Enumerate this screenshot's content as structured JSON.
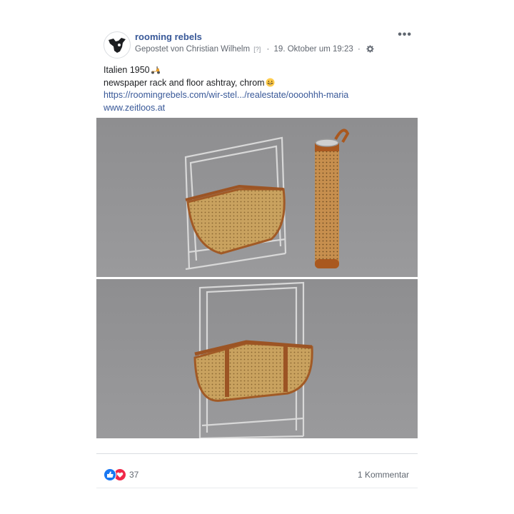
{
  "post": {
    "author": "rooming rebels",
    "posted_by": "Gepostet von Christian Wilhelm",
    "help_marker": "[?]",
    "separator": "·",
    "timestamp": "19. Oktober um 19:23",
    "lines": {
      "line1": "Italien 1950",
      "line2": "newspaper rack and floor ashtray, chrom",
      "link1": "https://roomingrebels.com/wir-stel.../realestate/oooohhh-maria",
      "link2": "www.zeitloos.at"
    },
    "icons": {
      "more": "more-options-icon",
      "audience": "gear-icon",
      "emoji1": "scooter-emoji",
      "emoji2": "grinning-emoji"
    },
    "photos": [
      {
        "subject": "photo-rack-and-ashtray"
      },
      {
        "subject": "photo-rack"
      }
    ]
  },
  "footer": {
    "reaction_count": "37",
    "comments_label": "1 Kommentar",
    "reactions": [
      "like",
      "love"
    ]
  },
  "colors": {
    "link": "#385898",
    "meta": "#616770",
    "like": "#1877f2",
    "love": "#f02849"
  }
}
